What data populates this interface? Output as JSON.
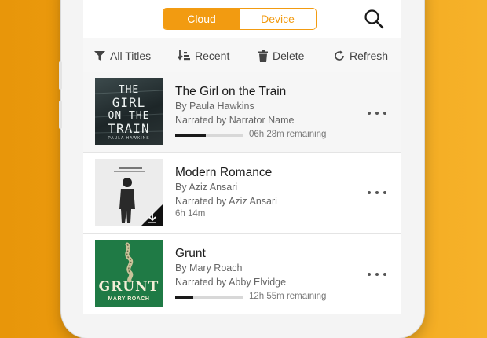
{
  "segmented": {
    "cloud": "Cloud",
    "device": "Device",
    "active": "cloud"
  },
  "toolbar": {
    "filter_label": "All Titles",
    "sort_label": "Recent",
    "delete_label": "Delete",
    "refresh_label": "Refresh"
  },
  "books": [
    {
      "title": "The Girl on the Train",
      "author": "By Paula Hawkins",
      "narrator": "Narrated by Narrator Name",
      "remaining": "06h 28m remaining",
      "progress": 0.45,
      "cover_text": [
        "THE",
        "GIRL",
        "ON THE",
        "TRAIN"
      ],
      "cover_author": "PAULA HAWKINS"
    },
    {
      "title": "Modern Romance",
      "author": "By Aziz Ansari",
      "narrator": "Narrated by Aziz Ansari",
      "duration": "6h 14m"
    },
    {
      "title": "Grunt",
      "author": "By Mary Roach",
      "narrator": "Narrated by Abby Elvidge",
      "remaining": "12h 55m remaining",
      "progress": 0.27,
      "cover_text": "GRUNT",
      "cover_author": "MARY ROACH"
    }
  ],
  "colors": {
    "accent": "#f29b11",
    "background": "#f0a012"
  }
}
